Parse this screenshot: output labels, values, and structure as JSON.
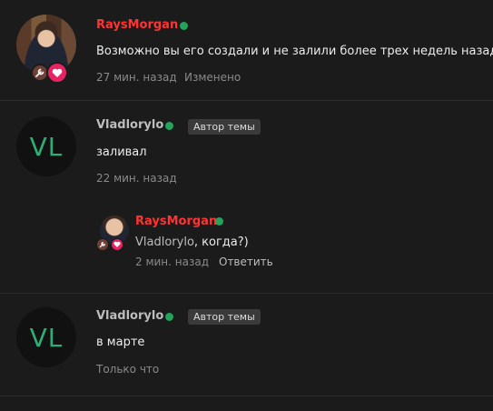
{
  "posts": [
    {
      "username": "RaysMorgan",
      "message": "Возможно вы его создали и не залили более трех недель назад",
      "time": "27 мин. назад",
      "edited_label": "Изменено",
      "avatar_icon": "user-photo",
      "badges": [
        "wrench-icon",
        "heart-icon"
      ]
    },
    {
      "username": "Vladlorylo",
      "author_badge": "Автор темы",
      "avatar_initials": "VL",
      "message": "заливал",
      "time": "22 мин. назад"
    },
    {
      "username": "RaysMorgan",
      "message_link": "Vladlorylo",
      "message_rest": ", когда?)",
      "time": "2 мин. назад",
      "reply_label": "Ответить",
      "avatar_icon": "user-photo",
      "badges": [
        "wrench-icon",
        "heart-icon"
      ]
    },
    {
      "username": "Vladlorylo",
      "author_badge": "Автор темы",
      "avatar_initials": "VL",
      "message": "в марте",
      "time": "Только что"
    }
  ],
  "colors": {
    "background": "#1b1b1b",
    "username_red": "#ff3333",
    "online_dot": "#22a45d",
    "initials_green": "#2fae74",
    "badge_pink": "#e62463",
    "badge_brown": "#6b3f36"
  }
}
